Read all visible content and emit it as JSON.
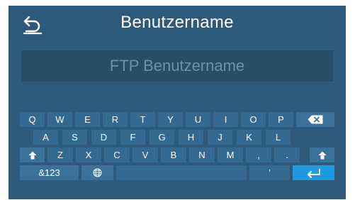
{
  "header": {
    "title": "Benutzername",
    "back_icon": "undo-arrow-icon"
  },
  "input": {
    "placeholder": "FTP Benutzername",
    "value": ""
  },
  "keyboard": {
    "row1": [
      "Q",
      "W",
      "E",
      "R",
      "T",
      "Y",
      "U",
      "I",
      "O",
      "P"
    ],
    "row2": [
      "A",
      "S",
      "D",
      "F",
      "G",
      "H",
      "J",
      "K",
      "L"
    ],
    "row3": [
      "Z",
      "X",
      "C",
      "V",
      "B",
      "N",
      "M",
      ",",
      "."
    ],
    "numbers_label": "&123",
    "apostrophe": "'",
    "icons": {
      "backspace": "backspace-icon",
      "shift": "shift-arrow-icon",
      "language": "globe-icon",
      "enter": "enter-return-icon"
    }
  },
  "colors": {
    "background": "#2e5a7b",
    "key": "#356a90",
    "enter_key": "#1e9be0"
  }
}
